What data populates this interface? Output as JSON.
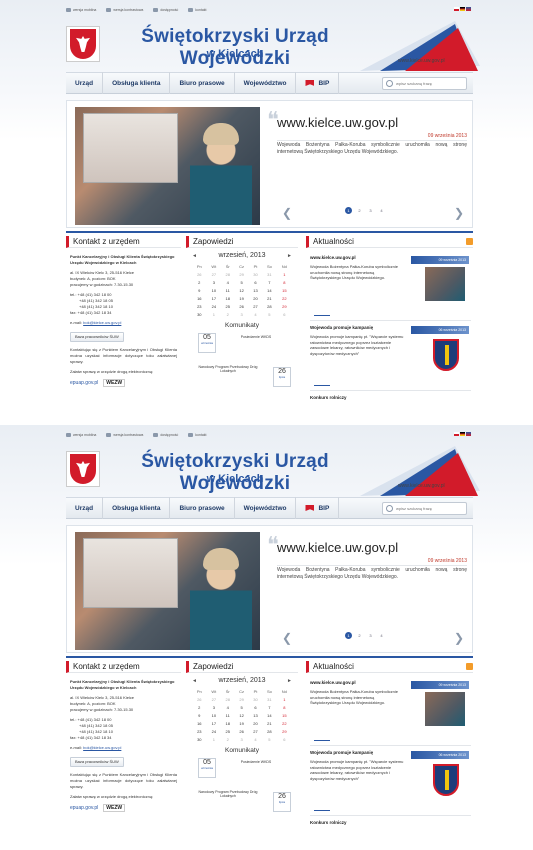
{
  "topbar": {
    "items": [
      "wersja mobilna",
      "wersja kontrastowa",
      "dostępność",
      "kontakt"
    ]
  },
  "header": {
    "title": "Świętokrzyski Urząd Wojewódzki",
    "subtitle": "w Kielcach",
    "url": "www.kielce.uw.gov.pl"
  },
  "nav": {
    "items": [
      "Urząd",
      "Obsługa klienta",
      "Biuro prasowe",
      "Województwo"
    ],
    "bip": "BIP",
    "search_placeholder": "wpisz szukaną frazę"
  },
  "slider": {
    "title": "www.kielce.uw.gov.pl",
    "date": "09 września 2013",
    "text": "Wojewoda Bożentyna Pałka-Koruba symbolicznie uruchomiła nową stronę internetową Świętokrzyskiego Urzędu Wojewódzkiego.",
    "pages": [
      "1",
      "2",
      "3",
      "4"
    ]
  },
  "contact": {
    "heading": "Kontakt z urzędem",
    "office_title": "Punkt Kancelaryjny i Obsługi Klienta Świętokrzyskiego Urzędu Wojewódzkiego w Kielcach",
    "address1": "al. IX Wieków Kielc 3, 25-516 Kielce",
    "address2": "budynek: A, poziom: BOK",
    "address3": "pracujemy w godzinach: 7.30-15.30",
    "tel1": "tel.: +48 (41) 342 18 00",
    "tel2": "+48 (41) 342 18 05",
    "tel3": "+48 (41) 342 18 10",
    "fax": "fax: +48 (41) 342 18 34",
    "email_label": "e-mail:",
    "email": "bok@kielce.uw.gov.pl",
    "staff_button": "Baza pracowników ŚUW",
    "note": "Kontaktując się z Punktem Kancelaryjnym i Obsługi Klienta można uzyskać informacje dotyczące toku załatwianej sprawy.",
    "electronic": "Załatw sprawę w urzędzie drogą elektroniczną:",
    "epuap": "epuap.gov.pl",
    "wezw": "WEZW"
  },
  "calendar": {
    "heading": "Zapowiedzi",
    "month": "wrzesień, 2013",
    "prev": "◄",
    "next": "►",
    "days": [
      "Pn",
      "Wt",
      "Śr",
      "Cz",
      "Pt",
      "So",
      "Nd"
    ],
    "weeks": [
      [
        "26",
        "27",
        "28",
        "29",
        "30",
        "31",
        "1"
      ],
      [
        "2",
        "3",
        "4",
        "5",
        "6",
        "7",
        "8"
      ],
      [
        "9",
        "10",
        "11",
        "12",
        "13",
        "14",
        "15"
      ],
      [
        "16",
        "17",
        "18",
        "19",
        "20",
        "21",
        "22"
      ],
      [
        "23",
        "24",
        "25",
        "26",
        "27",
        "28",
        "29"
      ],
      [
        "30",
        "1",
        "2",
        "3",
        "4",
        "5",
        "6"
      ]
    ],
    "komunikaty_heading": "Komunikaty",
    "kom1_day": "05",
    "kom1_month": "września",
    "kom1_text": "Posiedzenie WKDS",
    "kom2_day": "26",
    "kom2_month": "lipca",
    "kom2_text": "Narodowy Program Przebudowy Dróg Lokalnych"
  },
  "news": {
    "heading": "Aktualności",
    "items": [
      {
        "title": "www.kielce.uw.gov.pl",
        "date": "09 września 2013",
        "text": "Wojewoda Bożentyna Pałka-Koruba symbolicznie uruchomiła nową stronę internetową Świętokrzyskiego Urzędu Wojewódzkiego."
      },
      {
        "title": "Wojewoda promuje kampanię",
        "date": "06 września 2013",
        "text": "Wojewoda promuje kampanię pt. \"Wsparcie systemu ratownictwa medycznego poprzez kształcenie zawodowe lekarzy, ratowników medycznych i dyspozytorów medycznych\""
      }
    ],
    "last_title": "Konkurs rolniczy"
  }
}
